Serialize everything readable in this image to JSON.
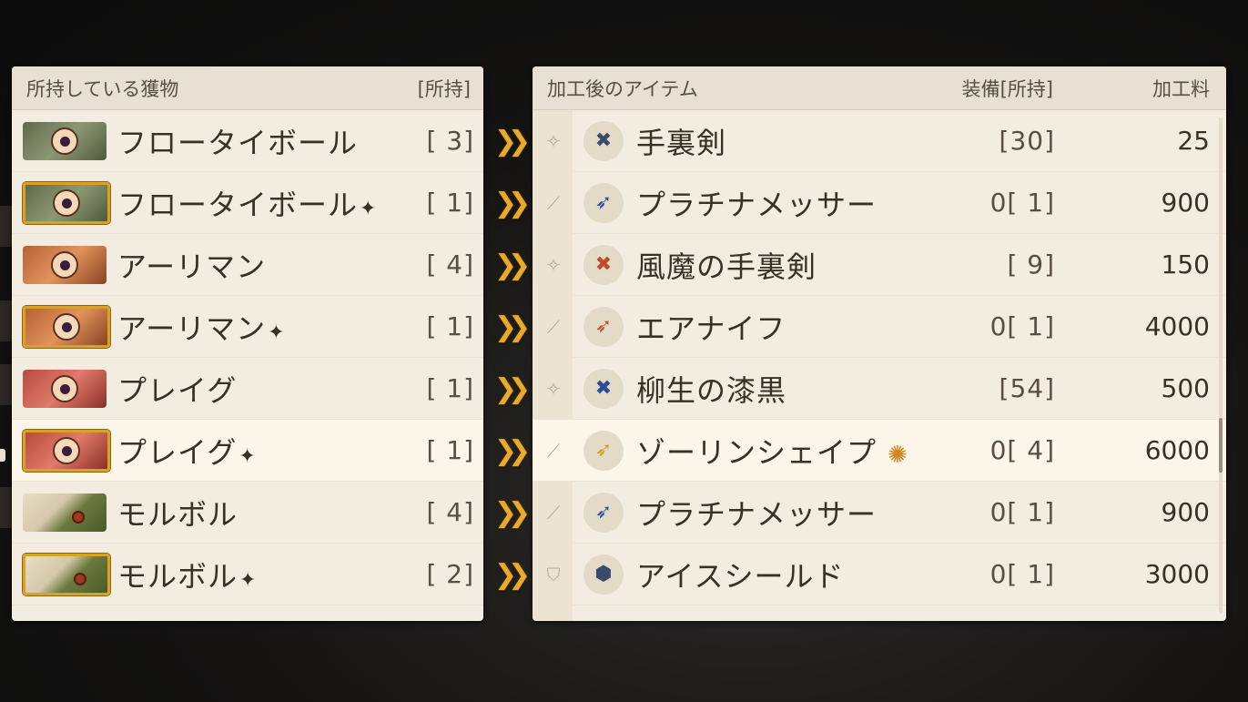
{
  "left_panel": {
    "title": "所持している獲物",
    "count_header": "[所持]",
    "items": [
      {
        "name": "フロータイボール",
        "hq": false,
        "count": "[ 3]",
        "color": "green"
      },
      {
        "name": "フロータイボール",
        "hq": true,
        "count": "[ 1]",
        "color": "green"
      },
      {
        "name": "アーリマン",
        "hq": false,
        "count": "[ 4]",
        "color": "orange"
      },
      {
        "name": "アーリマン",
        "hq": true,
        "count": "[ 1]",
        "color": "orange"
      },
      {
        "name": "プレイグ",
        "hq": false,
        "count": "[ 1]",
        "color": "red"
      },
      {
        "name": "プレイグ",
        "hq": true,
        "count": "[ 1]",
        "color": "red"
      },
      {
        "name": "モルボル",
        "hq": false,
        "count": "[ 4]",
        "color": "morbol"
      },
      {
        "name": "モルボル",
        "hq": true,
        "count": "[ 2]",
        "color": "morbol"
      }
    ],
    "hq_symbol": "✦",
    "selected_index": 5
  },
  "right_panel": {
    "title": "加工後のアイテム",
    "equip_header": "装備[所持]",
    "fee_header": "加工料",
    "items": [
      {
        "category_icon": "shuriken-icon",
        "icon": "shuriken-icon",
        "name": "手裏剣",
        "equip": "[30]",
        "fee": "25"
      },
      {
        "category_icon": "dagger-icon",
        "icon": "dagger-icon",
        "name": "プラチナメッサー",
        "equip": "0[ 1]",
        "fee": "900"
      },
      {
        "category_icon": "shuriken-icon",
        "icon": "shuriken-icon",
        "name": "風魔の手裏剣",
        "equip": "[ 9]",
        "fee": "150"
      },
      {
        "category_icon": "dagger-icon",
        "icon": "dagger-icon",
        "name": "エアナイフ",
        "equip": "0[ 1]",
        "fee": "4000"
      },
      {
        "category_icon": "shuriken-icon",
        "icon": "shuriken-icon",
        "name": "柳生の漆黒",
        "equip": "[54]",
        "fee": "500"
      },
      {
        "category_icon": "dagger-icon",
        "icon": "dagger-icon",
        "name": "ゾーリンシェイプ",
        "material_icon": true,
        "equip": "0[ 4]",
        "fee": "6000"
      },
      {
        "category_icon": "dagger-icon",
        "icon": "dagger-icon",
        "name": "プラチナメッサー",
        "equip": "0[ 1]",
        "fee": "900"
      },
      {
        "category_icon": "shield-icon",
        "icon": "shield-icon",
        "name": "アイスシールド",
        "equip": "0[ 1]",
        "fee": "3000"
      }
    ],
    "selected_index": 5
  },
  "arrow_glyph": "❯❯",
  "colors": {
    "panel_bg": "#f3ece0",
    "header_bg": "#e8e0d2",
    "arrow": "#e8aa2a",
    "hq_border": "#d9a227",
    "text": "#3a3026"
  }
}
